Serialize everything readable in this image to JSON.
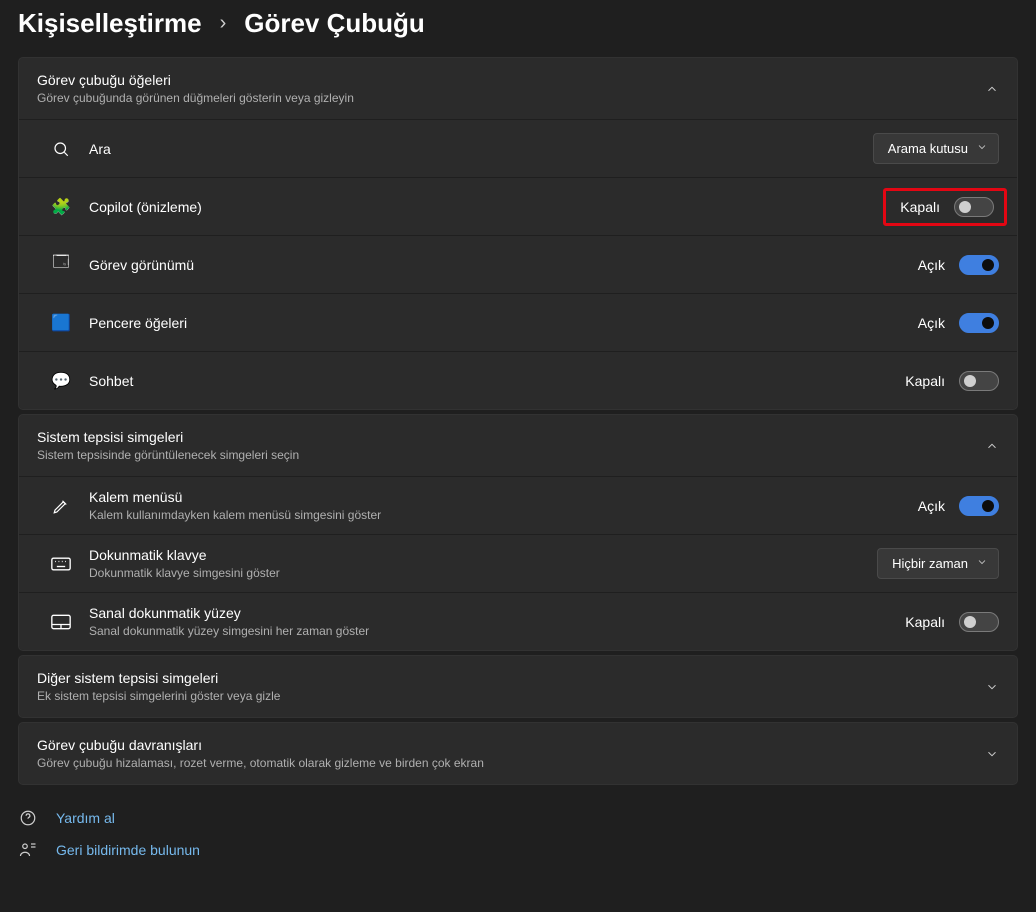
{
  "breadcrumb": {
    "parent": "Kişiselleştirme",
    "separator": "›",
    "current": "Görev Çubuğu"
  },
  "sections": {
    "taskbarItems": {
      "title": "Görev çubuğu öğeleri",
      "subtitle": "Görev çubuğunda görünen düğmeleri gösterin veya gizleyin",
      "rows": {
        "search": {
          "label": "Ara",
          "dropdown": "Arama kutusu"
        },
        "copilot": {
          "label": "Copilot (önizleme)",
          "state": "Kapalı",
          "on": false
        },
        "taskview": {
          "label": "Görev görünümü",
          "state": "Açık",
          "on": true
        },
        "widgets": {
          "label": "Pencere öğeleri",
          "state": "Açık",
          "on": true
        },
        "chat": {
          "label": "Sohbet",
          "state": "Kapalı",
          "on": false
        }
      }
    },
    "systemTray": {
      "title": "Sistem tepsisi simgeleri",
      "subtitle": "Sistem tepsisinde görüntülenecek simgeleri seçin",
      "rows": {
        "pen": {
          "label": "Kalem menüsü",
          "sub": "Kalem kullanımdayken kalem menüsü simgesini göster",
          "state": "Açık",
          "on": true
        },
        "touchkb": {
          "label": "Dokunmatik klavye",
          "sub": "Dokunmatik klavye simgesini göster",
          "dropdown": "Hiçbir zaman"
        },
        "vtouch": {
          "label": "Sanal dokunmatik yüzey",
          "sub": "Sanal dokunmatik yüzey simgesini her zaman göster",
          "state": "Kapalı",
          "on": false
        }
      }
    },
    "otherTray": {
      "title": "Diğer sistem tepsisi simgeleri",
      "subtitle": "Ek sistem tepsisi simgelerini göster veya gizle"
    },
    "behaviors": {
      "title": "Görev çubuğu davranışları",
      "subtitle": "Görev çubuğu hizalaması, rozet verme, otomatik olarak gizleme ve birden çok ekran"
    }
  },
  "footer": {
    "help": "Yardım al",
    "feedback": "Geri bildirimde bulunun"
  }
}
